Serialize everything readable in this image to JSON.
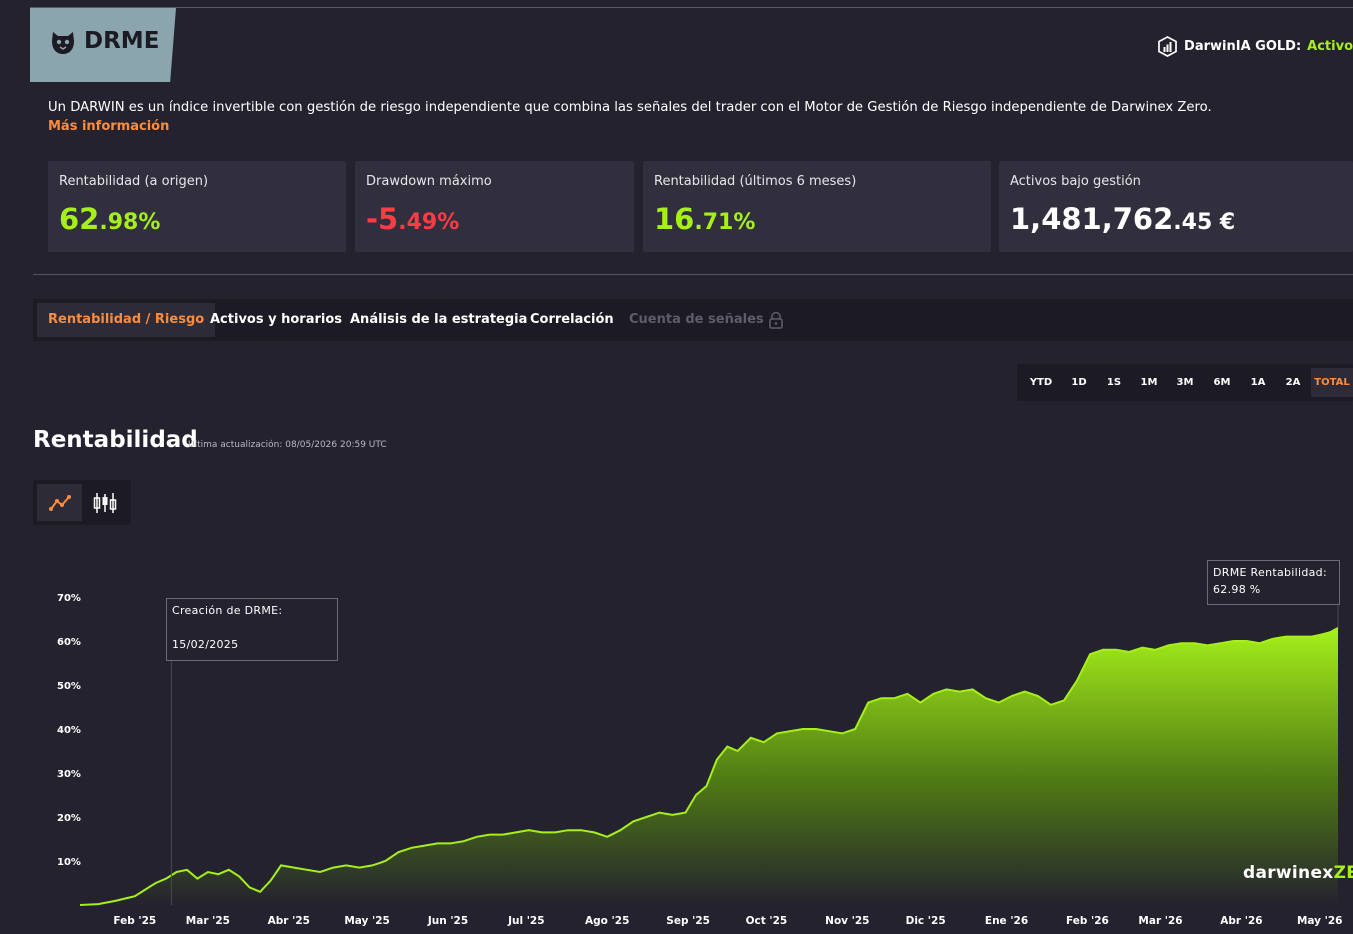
{
  "header": {
    "darwin_name": "DRME",
    "gold_label": "DarwinIA GOLD:",
    "gold_status": "Activo"
  },
  "intro": {
    "text": "Un DARWIN es un índice invertible con gestión de riesgo independiente que combina las señales del trader con el Motor de Gestión de Riesgo independiente de Darwinex Zero.",
    "more_link": "Más información"
  },
  "stats": [
    {
      "label": "Rentabilidad (a origen)",
      "value_main": "62",
      "value_rest": ".98%",
      "tone": "green"
    },
    {
      "label": "Drawdown máximo",
      "value_main": "-5",
      "value_rest": ".49%",
      "tone": "red"
    },
    {
      "label": "Rentabilidad (últimos 6 meses)",
      "value_main": "16",
      "value_rest": ".71%",
      "tone": "green"
    },
    {
      "label": "Activos bajo gestión",
      "value_main": "1,481,762",
      "value_rest": ".45 €",
      "tone": "white"
    }
  ],
  "tabs": [
    {
      "label": "Rentabilidad / Riesgo",
      "active": true
    },
    {
      "label": "Activos y horarios"
    },
    {
      "label": "Análisis de la estrategia"
    },
    {
      "label": "Correlación"
    },
    {
      "label": "Cuenta de señales",
      "locked": true
    }
  ],
  "periods": [
    "YTD",
    "1D",
    "1S",
    "1M",
    "3M",
    "6M",
    "1A",
    "2A",
    "TOTAL"
  ],
  "active_period": "TOTAL",
  "chart_section": {
    "title": "Rentabilidad",
    "last_update": "Última actualización: 08/05/2026 20:59 UTC",
    "chart_types": [
      "line-chart-icon",
      "candlestick-icon"
    ],
    "active_chart_type": "line-chart-icon"
  },
  "tooltips": {
    "creation_label": "Creación de DRME:",
    "creation_date": "15/02/2025",
    "current_label": "DRME Rentabilidad:",
    "current_value": "62.98 %"
  },
  "watermark": {
    "main": "darwinex",
    "suffix": "ZERO"
  },
  "colors": {
    "accent": "#ff8c3a",
    "positive": "#a6f01a",
    "negative": "#ff3b46",
    "background": "#24222f"
  },
  "chart_data": {
    "type": "area",
    "title": "Rentabilidad",
    "xlabel": "",
    "ylabel": "",
    "y_unit": "%",
    "ylim": [
      0,
      70
    ],
    "y_ticks": [
      10,
      20,
      30,
      40,
      50,
      60,
      70
    ],
    "y_tick_labels": [
      "10%",
      "20%",
      "30%",
      "40%",
      "50%",
      "60%",
      "70%"
    ],
    "x_tick_labels": [
      "Feb '25",
      "Mar '25",
      "Abr '25",
      "May '25",
      "Jun '25",
      "Jul '25",
      "Ago '25",
      "Sep '25",
      "Oct '25",
      "Nov '25",
      "Dic '25",
      "Ene '26",
      "Feb '26",
      "Mar '26",
      "Abr '26",
      "May '26"
    ],
    "x_tick_dates": [
      "2025-02-01",
      "2025-03-01",
      "2025-04-01",
      "2025-05-01",
      "2025-06-01",
      "2025-07-01",
      "2025-08-01",
      "2025-09-01",
      "2025-10-01",
      "2025-11-01",
      "2025-12-01",
      "2026-01-01",
      "2026-02-01",
      "2026-03-01",
      "2026-04-01",
      "2026-05-01"
    ],
    "xlim": [
      "2025-01-11",
      "2026-05-08"
    ],
    "grid": false,
    "legend": "none",
    "series": [
      {
        "fill": "gradient green",
        "x": [
          "2025-01-11",
          "2025-01-18",
          "2025-01-25",
          "2025-02-01",
          "2025-02-05",
          "2025-02-09",
          "2025-02-13",
          "2025-02-17",
          "2025-02-21",
          "2025-02-25",
          "2025-03-01",
          "2025-03-05",
          "2025-03-09",
          "2025-03-13",
          "2025-03-17",
          "2025-03-21",
          "2025-03-25",
          "2025-03-29",
          "2025-04-03",
          "2025-04-08",
          "2025-04-13",
          "2025-04-18",
          "2025-04-23",
          "2025-04-28",
          "2025-05-03",
          "2025-05-08",
          "2025-05-13",
          "2025-05-18",
          "2025-05-23",
          "2025-05-28",
          "2025-06-02",
          "2025-06-07",
          "2025-06-12",
          "2025-06-17",
          "2025-06-22",
          "2025-06-27",
          "2025-07-02",
          "2025-07-07",
          "2025-07-12",
          "2025-07-17",
          "2025-07-22",
          "2025-07-27",
          "2025-08-01",
          "2025-08-06",
          "2025-08-11",
          "2025-08-16",
          "2025-08-21",
          "2025-08-26",
          "2025-08-31",
          "2025-09-04",
          "2025-09-08",
          "2025-09-12",
          "2025-09-16",
          "2025-09-20",
          "2025-09-25",
          "2025-09-30",
          "2025-10-05",
          "2025-10-10",
          "2025-10-15",
          "2025-10-20",
          "2025-10-25",
          "2025-10-30",
          "2025-11-04",
          "2025-11-09",
          "2025-11-14",
          "2025-11-19",
          "2025-11-24",
          "2025-11-29",
          "2025-12-04",
          "2025-12-09",
          "2025-12-14",
          "2025-12-19",
          "2025-12-24",
          "2025-12-29",
          "2026-01-03",
          "2026-01-08",
          "2026-01-13",
          "2026-01-18",
          "2026-01-23",
          "2026-01-28",
          "2026-02-02",
          "2026-02-07",
          "2026-02-12",
          "2026-02-17",
          "2026-02-22",
          "2026-02-27",
          "2026-03-04",
          "2026-03-09",
          "2026-03-14",
          "2026-03-19",
          "2026-03-24",
          "2026-03-29",
          "2026-04-03",
          "2026-04-08",
          "2026-04-13",
          "2026-04-18",
          "2026-04-23",
          "2026-04-28",
          "2026-05-02",
          "2026-05-05",
          "2026-05-08"
        ],
        "values": [
          0.0,
          0.2,
          1.0,
          2.0,
          3.5,
          5.0,
          6.0,
          7.5,
          8.0,
          6.0,
          7.5,
          7.0,
          8.0,
          6.5,
          4.0,
          3.0,
          5.5,
          9.0,
          8.5,
          8.0,
          7.5,
          8.5,
          9.0,
          8.5,
          9.0,
          10.0,
          12.0,
          13.0,
          13.5,
          14.0,
          14.0,
          14.5,
          15.5,
          16.0,
          16.0,
          16.5,
          17.0,
          16.5,
          16.5,
          17.0,
          17.0,
          16.5,
          15.5,
          17.0,
          19.0,
          20.0,
          21.0,
          20.5,
          21.0,
          25.0,
          27.0,
          33.0,
          36.0,
          35.0,
          38.0,
          37.0,
          39.0,
          39.5,
          40.0,
          40.0,
          39.5,
          39.0,
          40.0,
          46.0,
          47.0,
          47.0,
          48.0,
          46.0,
          48.0,
          49.0,
          48.5,
          49.0,
          47.0,
          46.0,
          47.5,
          48.5,
          47.5,
          45.5,
          46.5,
          51.0,
          57.0,
          58.0,
          58.0,
          57.5,
          58.5,
          58.0,
          59.0,
          59.5,
          59.5,
          59.0,
          59.5,
          60.0,
          60.0,
          59.5,
          60.5,
          61.0,
          61.0,
          61.0,
          61.5,
          62.0,
          62.98
        ]
      }
    ],
    "annotations": [
      {
        "label": "Creación de DRME:",
        "date": "2025-02-15"
      },
      {
        "label": "DRME Rentabilidad:",
        "value": 62.98
      }
    ]
  }
}
